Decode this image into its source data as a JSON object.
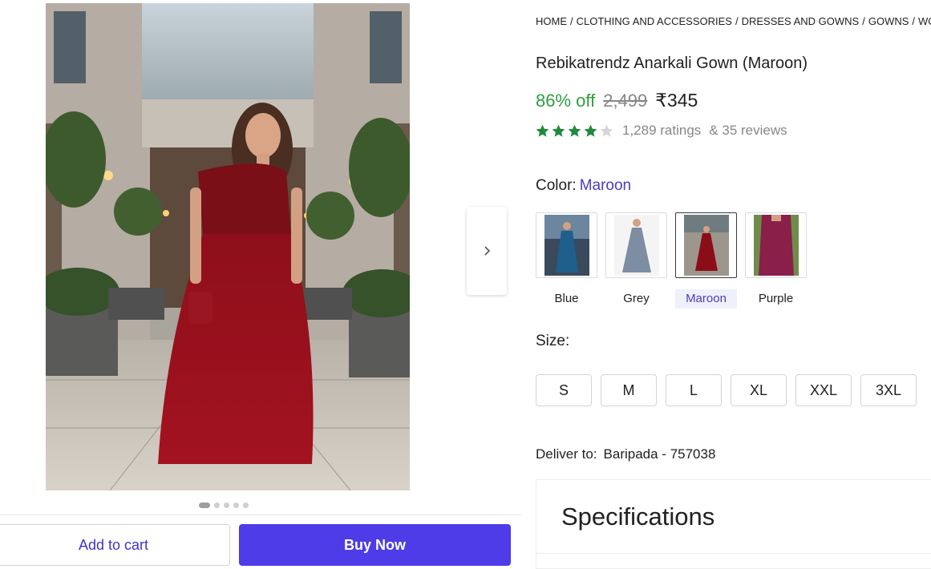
{
  "breadcrumb": [
    "HOME",
    "CLOTHING AND ACCESSORIES",
    "DRESSES AND GOWNS",
    "GOWNS",
    "WOMEN'S GOWNS"
  ],
  "product": {
    "title": "Rebikatrendz Anarkali Gown (Maroon)",
    "discount": "86% off",
    "mrp": "2,499",
    "price": "₹345",
    "rating_stars": 4,
    "ratings_text": "1,289 ratings",
    "reviews_text": "& 35 reviews"
  },
  "color": {
    "label": "Color:",
    "selected": "Maroon",
    "options": [
      {
        "name": "Blue",
        "hex": "#1f5f8b"
      },
      {
        "name": "Grey",
        "hex": "#7d8ea3"
      },
      {
        "name": "Maroon",
        "hex": "#8b0d18"
      },
      {
        "name": "Purple",
        "hex": "#8a1f4a"
      }
    ]
  },
  "size": {
    "label": "Size:",
    "options": [
      "S",
      "M",
      "L",
      "XL",
      "XXL",
      "3XL"
    ]
  },
  "delivery": {
    "label": "Deliver to:",
    "location": "Baripada - 757038"
  },
  "specifications": {
    "title": "Specifications"
  },
  "actions": {
    "add_to_cart": "Add to cart",
    "buy_now": "Buy Now"
  },
  "carousel": {
    "total": 5,
    "active": 1
  },
  "colors": {
    "accent": "#4d3ce8",
    "discount": "#2e9e3f",
    "star": "#1f8a3a",
    "link": "#4b3bbf"
  },
  "icons": {
    "next": "chevron-right-icon",
    "star": "star-icon"
  }
}
